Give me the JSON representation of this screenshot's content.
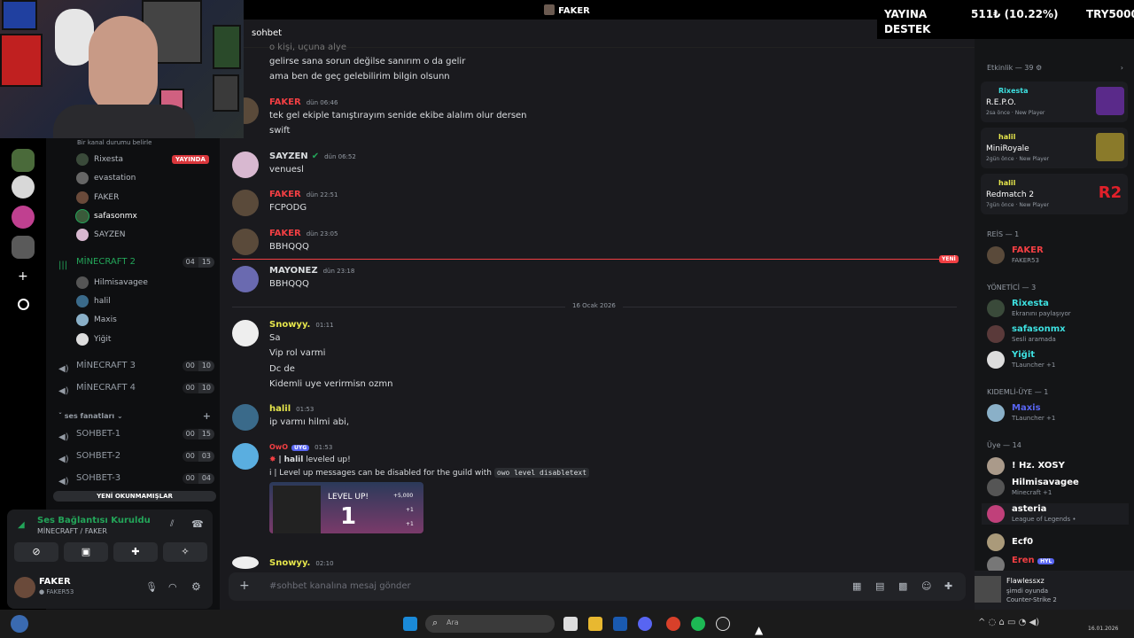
{
  "window": {
    "title": "FAKER"
  },
  "channel_header": {
    "name": "sohbet"
  },
  "overlay": {
    "support_line1": "YAYINA",
    "support_line2": "DESTEK",
    "amount": "511₺ (10.22%)",
    "goal": "TRY5000"
  },
  "channels": {
    "status_hint": "Bir kanal durumu belirle",
    "live_badge": "YAYINDA",
    "voice1_users": [
      "Rixesta",
      "evastation",
      "FAKER",
      "safasonmx",
      "SAYZEN"
    ],
    "voice2": {
      "name": "MİNECRAFT 2",
      "count": "04",
      "limit": "15",
      "users": [
        "Hilmisavagee",
        "halil",
        "Maxis",
        "Yiğit"
      ]
    },
    "voice3": {
      "name": "MİNECRAFT 3",
      "count": "00",
      "limit": "10"
    },
    "voice4": {
      "name": "MİNECRAFT 4",
      "count": "00",
      "limit": "10"
    },
    "category": "ses fanatları",
    "sohbet1": {
      "name": "SOHBET-1",
      "count": "00",
      "limit": "15"
    },
    "sohbet2": {
      "name": "SOHBET-2",
      "count": "00",
      "limit": "03"
    },
    "sohbet3": {
      "name": "SOHBET-3",
      "count": "00",
      "limit": "04"
    },
    "unread_banner": "YENİ OKUNMAMIŞLAR"
  },
  "voice_panel": {
    "status": "Ses Bağlantısı Kuruldu",
    "location": "MİNECRAFT / FAKER"
  },
  "user_panel": {
    "name": "FAKER",
    "tag": "FAKER53"
  },
  "messages": {
    "top_cut": "o kişi, uçuna alye",
    "m0_l1": "gelirse sana sorun değilse sanırım o da gelir",
    "m0_l2": "ama ben de geç gelebilirim bilgin olsunn",
    "m1": {
      "author": "FAKER",
      "time": "dün 06:46",
      "l1": "tek gel ekiple tanıştırayım senide ekibe alalım olur dersen",
      "l2": "swift"
    },
    "m2": {
      "author": "SAYZEN",
      "time": "dün 06:52",
      "l1": "venuesl"
    },
    "m3": {
      "author": "FAKER",
      "time": "dün 22:51",
      "l1": "FCPODG"
    },
    "m4": {
      "author": "FAKER",
      "time": "dün 23:05",
      "l1": "BBHQQQ"
    },
    "new_badge": "YENİ",
    "m5": {
      "author": "MAYONEZ",
      "time": "dün 23:18",
      "l1": "BBHQQQ"
    },
    "date_divider": "16 Ocak 2026",
    "m6": {
      "author": "Snowyy.",
      "time": "01:11",
      "l1": "Sa",
      "l2": "Vip rol varmi",
      "l3": "Dc de",
      "l4": "Kidemli uye verirmisn ozmn"
    },
    "m7": {
      "author": "halil",
      "time": "01:53",
      "l1": "ip varmı hilmi abi,"
    },
    "m8": {
      "author": "OwO",
      "bot_tag": "UYG",
      "time": "01:53",
      "l1_name": "halil",
      "l1_rest": "leveled up!",
      "l2": "Level up messages can be disabled for the guild with",
      "l2_code": "owo level disabletext",
      "card_title": "LEVEL UP!",
      "card_level": "1",
      "card_r1": "+5,000",
      "card_r2": "+1",
      "card_r3": "+1"
    },
    "m9": {
      "author": "Snowyy.",
      "time": "02:10"
    }
  },
  "composer": {
    "placeholder": "#sohbet kanalına mesaj gönder"
  },
  "members": {
    "activity_header": "Etkinlik — 39",
    "activities": [
      {
        "user": "Rixesta",
        "game": "R.E.P.O.",
        "ago": "2sa önce",
        "tag": "New Player"
      },
      {
        "user": "halil",
        "game": "MiniRoyale",
        "ago": "2gün önce",
        "tag": "New Player"
      },
      {
        "user": "halil",
        "game": "Redmatch 2",
        "ago": "7gün önce",
        "tag": "New Player"
      }
    ],
    "reis_header": "REİS — 1",
    "reis": {
      "name": "FAKER",
      "sub": "FAKER53"
    },
    "yonetici_header": "YÖNETİCİ — 3",
    "yonetici": [
      {
        "name": "Rixesta",
        "sub": "Ekranını paylaşıyor"
      },
      {
        "name": "safasonmx",
        "sub": "Sesli aramada"
      },
      {
        "name": "Yiğit",
        "sub": "TLauncher +1"
      }
    ],
    "kidemli_header": "KIDEMLİ-ÜYE — 1",
    "kidemli": {
      "name": "Maxis",
      "sub": "TLauncher +1"
    },
    "uye_header": "Üye — 14",
    "uye": [
      {
        "name": "! Hz. XOSY",
        "sub": ""
      },
      {
        "name": "Hilmisavagee",
        "sub": "Minecraft +1"
      },
      {
        "name": "asteria",
        "sub": "League of Legends •"
      },
      {
        "name": "Ecf0",
        "sub": ""
      },
      {
        "name": "Eren",
        "sub": "HYL"
      }
    ],
    "now_playing": {
      "name": "Flawlessxz",
      "status": "şimdi oyunda",
      "game": "Counter-Strike 2"
    }
  },
  "taskbar": {
    "search_placeholder": "Ara",
    "date": "16.01.2026"
  },
  "colors": {
    "accent": "#5865f2",
    "red": "#f23f43",
    "green": "#23a559",
    "yellow": "#e6e64c",
    "cyan": "#3de0e0"
  }
}
